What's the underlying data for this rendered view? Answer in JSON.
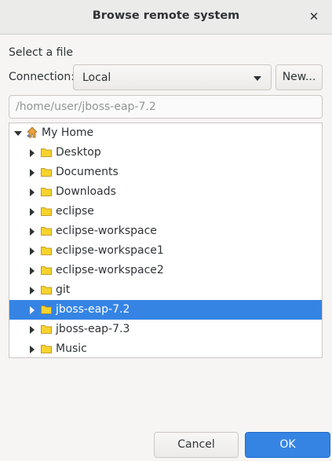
{
  "dialog": {
    "title": "Browse remote system",
    "close_symbol": "✕"
  },
  "subtitle": "Select a file",
  "connection": {
    "label": "Connection:",
    "selected": "Local",
    "new_button": "New..."
  },
  "path_field": {
    "placeholder": "/home/user/jboss-eap-7.2"
  },
  "tree": {
    "root": {
      "label": "My Home",
      "icon": "home-network-icon",
      "expanded": true
    },
    "items": [
      {
        "label": "Desktop"
      },
      {
        "label": "Documents"
      },
      {
        "label": "Downloads"
      },
      {
        "label": "eclipse"
      },
      {
        "label": "eclipse-workspace"
      },
      {
        "label": "eclipse-workspace1"
      },
      {
        "label": "eclipse-workspace2"
      },
      {
        "label": "git"
      },
      {
        "label": "jboss-eap-7.2",
        "selected": true
      },
      {
        "label": "jboss-eap-7.3"
      },
      {
        "label": "Music"
      }
    ]
  },
  "buttons": {
    "cancel": "Cancel",
    "ok": "OK"
  },
  "colors": {
    "accent": "#3584e4",
    "folder": "#f6d32d"
  }
}
